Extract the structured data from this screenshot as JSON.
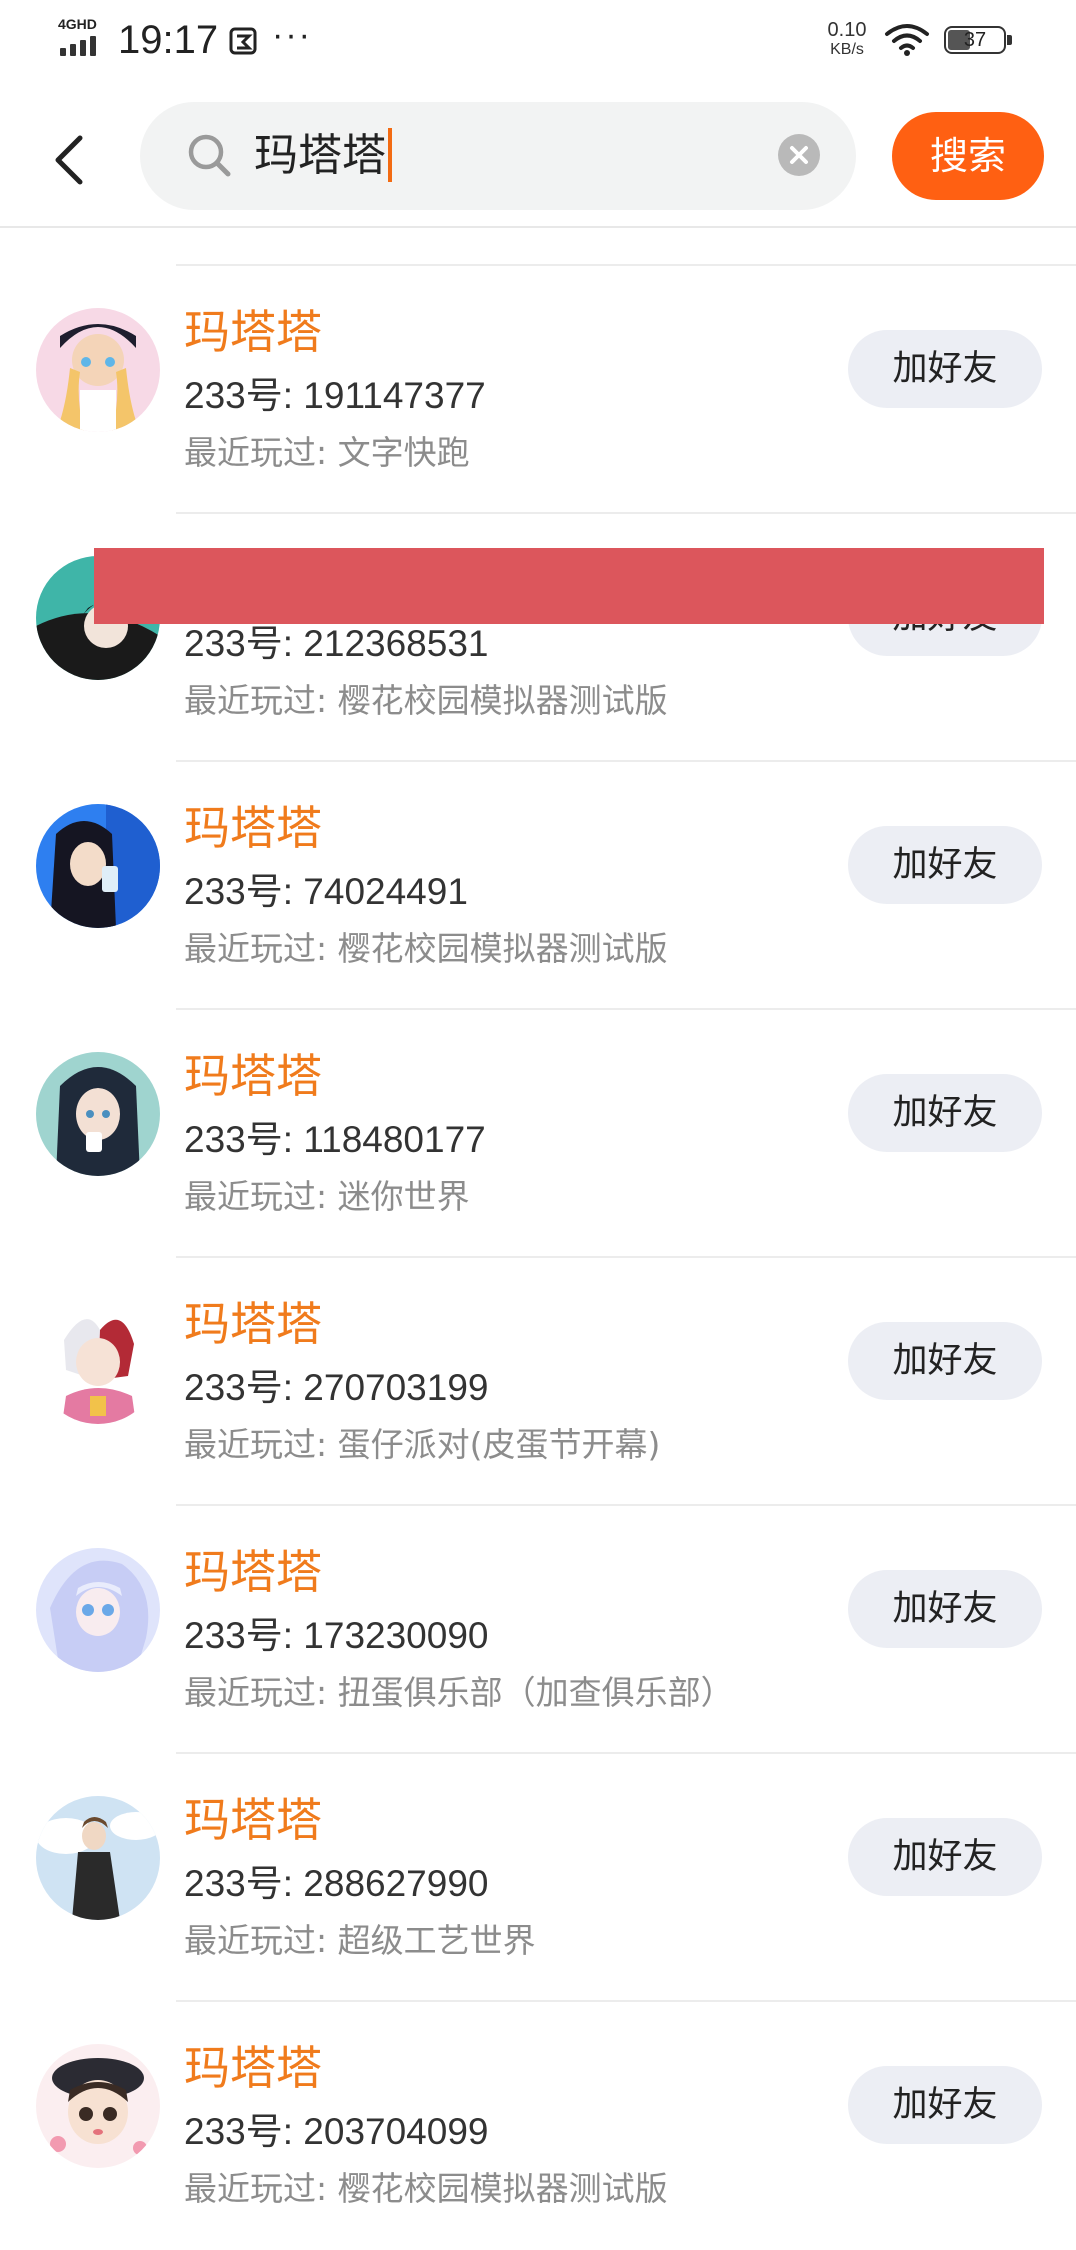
{
  "status_bar": {
    "network": "4GHD",
    "time": "19:17",
    "more": "···",
    "speed_value": "0.10",
    "speed_unit": "KB/s",
    "battery": "37"
  },
  "search": {
    "query": "玛塔塔",
    "button_label": "搜索"
  },
  "colors": {
    "accent": "#ff6012",
    "name_text": "#f07b1c",
    "redaction": "#dc565c"
  },
  "results": [
    {
      "name": "玛塔塔",
      "uid": "233号: 191147377",
      "played": "最近玩过: 文字快跑",
      "button": "加好友"
    },
    {
      "name": "",
      "uid": "233号: 212368531",
      "played": "最近玩过: 樱花校园模拟器测试版",
      "button": "加好友"
    },
    {
      "name": "玛塔塔",
      "uid": "233号: 74024491",
      "played": "最近玩过: 樱花校园模拟器测试版",
      "button": "加好友"
    },
    {
      "name": "玛塔塔",
      "uid": "233号: 118480177",
      "played": "最近玩过: 迷你世界",
      "button": "加好友"
    },
    {
      "name": "玛塔塔",
      "uid": "233号: 270703199",
      "played": "最近玩过: 蛋仔派对(皮蛋节开幕)",
      "button": "加好友"
    },
    {
      "name": "玛塔塔",
      "uid": "233号: 173230090",
      "played": "最近玩过: 扭蛋俱乐部（加查俱乐部）",
      "button": "加好友"
    },
    {
      "name": "玛塔塔",
      "uid": "233号: 288627990",
      "played": "最近玩过: 超级工艺世界",
      "button": "加好友"
    },
    {
      "name": "玛塔塔",
      "uid": "233号: 203704099",
      "played": "最近玩过: 樱花校园模拟器测试版",
      "button": "加好友"
    }
  ]
}
